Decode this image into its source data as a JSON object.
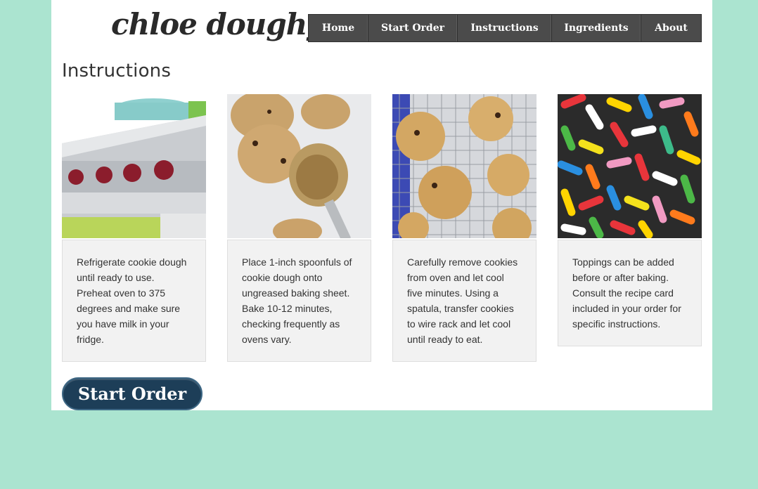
{
  "site": {
    "logo_text": "chloe doughy"
  },
  "nav": {
    "items": [
      {
        "label": "Home"
      },
      {
        "label": "Start Order"
      },
      {
        "label": "Instructions"
      },
      {
        "label": "Ingredients"
      },
      {
        "label": "About"
      }
    ]
  },
  "page": {
    "title": "Instructions"
  },
  "steps": [
    {
      "image": "oven-photo",
      "text": "Refrigerate cookie dough until ready to use. Preheat oven to 375 degrees and make sure you have milk in your fridge."
    },
    {
      "image": "cookie-dough-scoop-photo",
      "text": "Place 1-inch spoonfuls of cookie dough onto ungreased baking sheet. Bake 10-12 minutes, checking frequently as ovens vary."
    },
    {
      "image": "cookies-on-rack-photo",
      "text": "Carefully remove cookies from oven and let cool five minutes. Using a spatula, transfer cookies to wire rack and let cool until ready to eat."
    },
    {
      "image": "sprinkles-photo",
      "text": "Toppings can be added before or after baking. Consult the recipe card included in your order for specific instructions."
    }
  ],
  "cta": {
    "label": "Start Order"
  },
  "colors": {
    "background": "#abe4d0",
    "nav": "#4b4b4b",
    "cta": "#1d3e58",
    "card": "#f2f2f2"
  }
}
